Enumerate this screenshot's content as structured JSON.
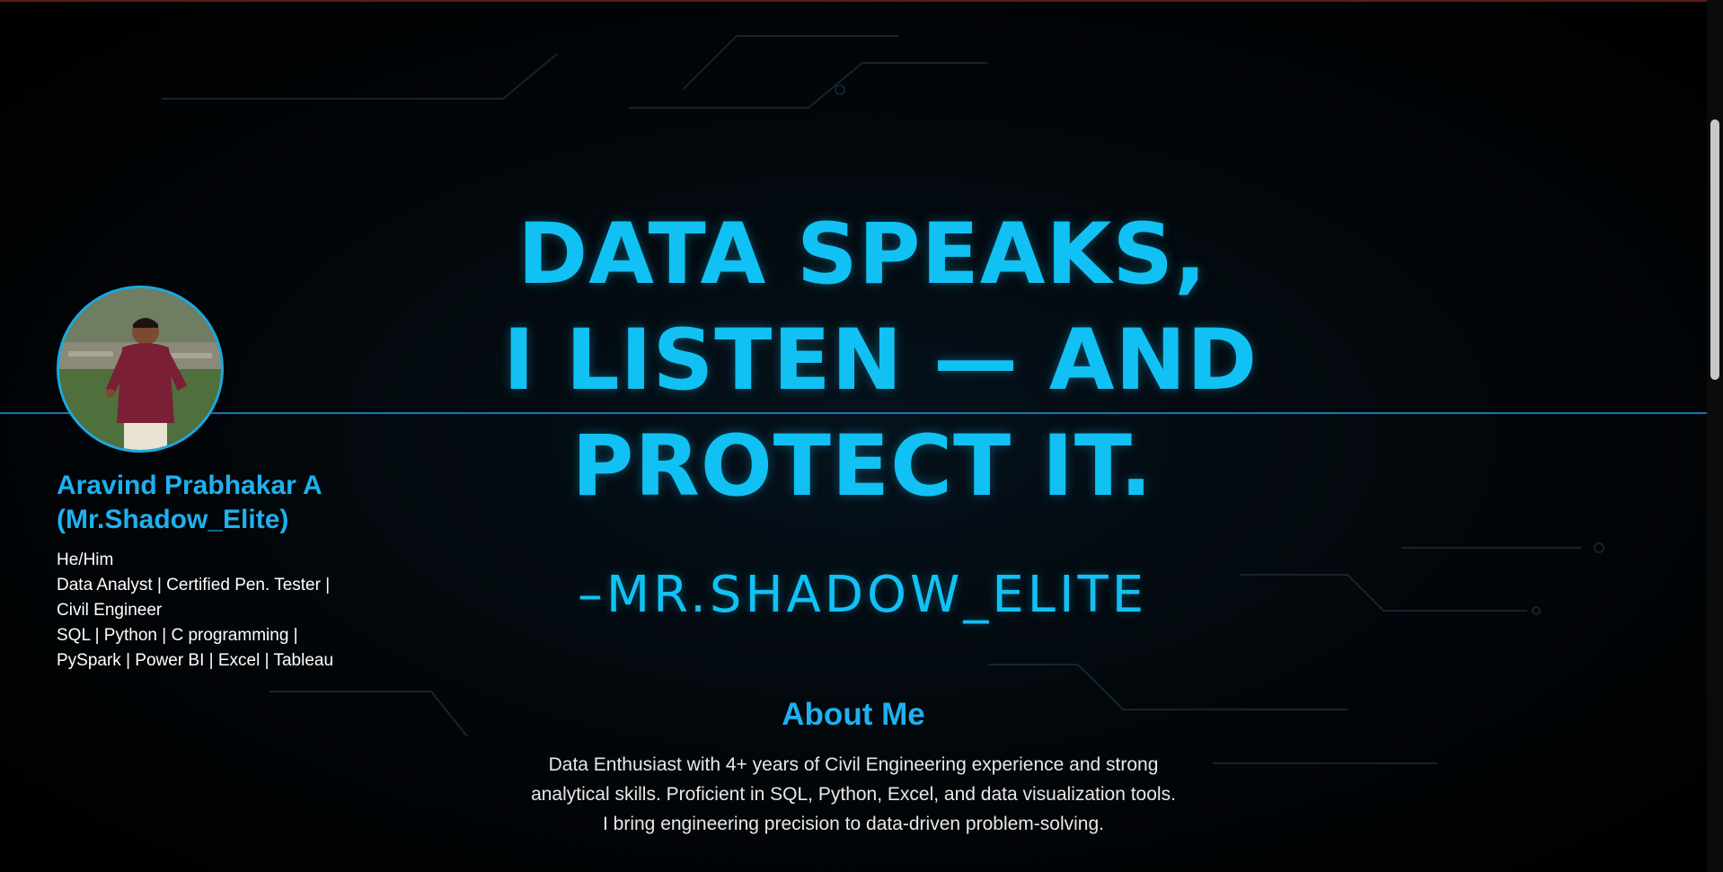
{
  "profile": {
    "name_line1": "Aravind Prabhakar A",
    "name_line2": "(Mr.Shadow_Elite)",
    "info_lines": [
      "He/Him",
      "Data Analyst | Certified Pen. Tester |",
      "Civil Engineer",
      "SQL | Python | C programming |",
      "PySpark | Power BI | Excel | Tableau"
    ],
    "avatar_icon": "person-photo"
  },
  "hero": {
    "quote_lines": [
      "DATA SPEAKS,",
      "I LISTEN — AND",
      "PROTECT IT."
    ],
    "signature": "–MR.SHADOW_ELITE"
  },
  "about": {
    "title": "About Me",
    "text": "Data Enthusiast with 4+ years of Civil Engineering experience and strong analytical skills. Proficient in SQL, Python, Excel, and data visualization tools. I bring engineering precision to data-driven problem-solving."
  },
  "colors": {
    "accent": "#1fb0ef",
    "quote": "#12c1f3",
    "background": "#000000",
    "text": "#ffffff"
  }
}
